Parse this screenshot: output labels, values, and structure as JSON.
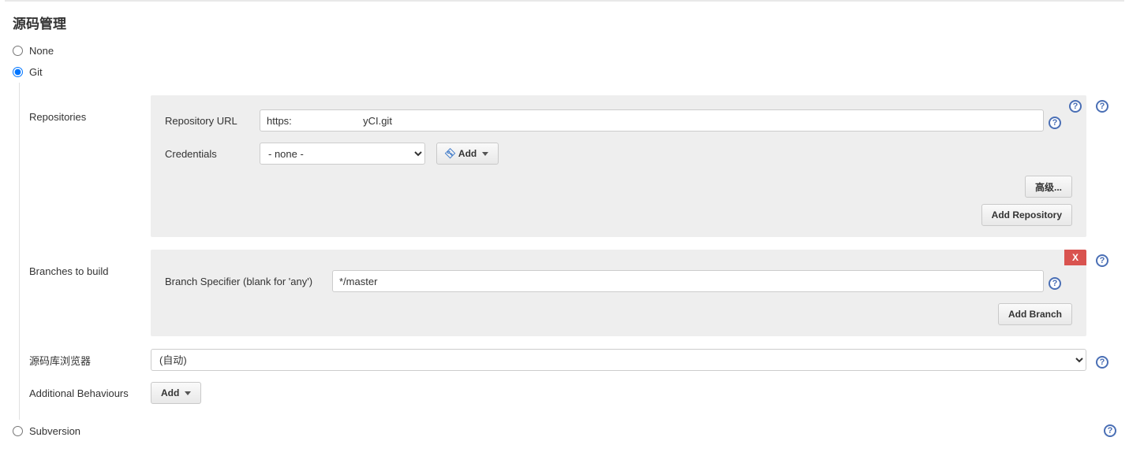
{
  "section_title": "源码管理",
  "options": {
    "none": "None",
    "git": "Git",
    "subversion": "Subversion"
  },
  "repositories": {
    "label": "Repositories",
    "url_label": "Repository URL",
    "url_value": "https:                         yCI.git",
    "credentials_label": "Credentials",
    "credentials_value": "- none -",
    "add_label": "Add",
    "advanced_label": "高级...",
    "add_repo_label": "Add Repository"
  },
  "branches": {
    "label": "Branches to build",
    "specifier_label": "Branch Specifier (blank for 'any')",
    "specifier_value": "*/master",
    "add_branch_label": "Add Branch",
    "delete_x": "X"
  },
  "browser": {
    "label": "源码库浏览器",
    "value": "(自动)"
  },
  "behaviours": {
    "label": "Additional Behaviours",
    "add_label": "Add"
  },
  "help_glyph": "?"
}
